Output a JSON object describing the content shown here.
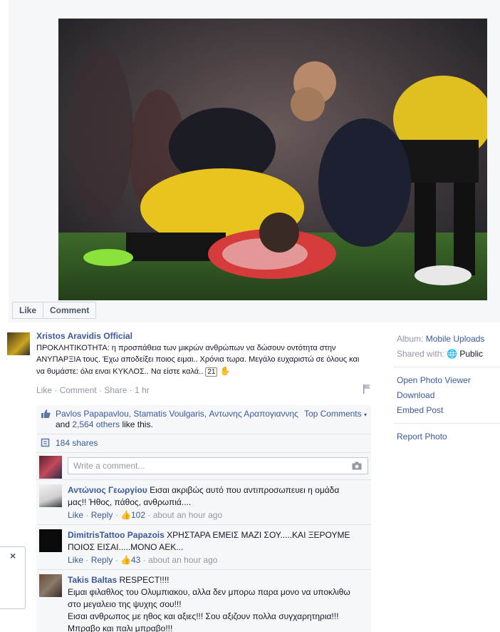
{
  "actions": {
    "like": "Like",
    "comment": "Comment"
  },
  "post": {
    "author": "Xristos Aravidis Official",
    "caption": "ΠΡΟΚΛΗΤΙΚΟΤΗΤΑ: η προσπάθεια των μικρών ανθρώπων να δώσουν οντότητα στην ΑΝΥΠΑΡΞΙΑ τους. Έχω αποδείξει ποιος ειμαι.. Χρόνια τωρα. Μεγάλο ευχαριστώ σε όλους και να θυμάστε: όλα ειναι ΚΥΚΛΟΣ.. Να είστε καλά..",
    "caption_tag": "21",
    "meta": {
      "like": "Like",
      "comment": "Comment",
      "share": "Share",
      "time": "1 hr"
    }
  },
  "likes": {
    "names": "Pavlos Papapavlou, Stamatis Voulgaris, Αντωνης Αραπογιαννης",
    "and": "and",
    "others": "2,564 others",
    "suffix": "like this.",
    "top_comments": "Top Comments",
    "shares": "184 shares",
    "write_placeholder": "Write a comment..."
  },
  "comments": [
    {
      "name": "Αντώνιος Γεωργίου",
      "lines": [
        "Εισαι ακριβώς αυτό που αντιπροσωπευει η ομάδα",
        "μας!! Ήθος, πάθος, ανθρωπιά...."
      ],
      "like": "Like",
      "reply": "Reply",
      "likes": "102",
      "time": "about an hour ago"
    },
    {
      "name": "DimitrisTattoo Papazois",
      "lines": [
        "ΧΡΗΣΤΑΡΑ ΕΜΕΙΣ ΜΑΖΙ ΣΟΥ.....ΚΑΙ ΞΕΡΟΥΜΕ",
        "ΠΟΙΟΣ ΕΙΣΑΙ.....ΜΟΝΟ ΑΕΚ..."
      ],
      "like": "Like",
      "reply": "Reply",
      "likes": "43",
      "time": "about an hour ago"
    },
    {
      "name": "Takis Baltas",
      "lines": [
        "RESPECT!!!!",
        "Ειμαι φιλαθλος του Ολυμπιακου, αλλα δεν μπορω παρα μονο να υποκλιθω",
        "στο μεγαλειο της ψυχης σου!!!",
        "Εισαι ανθρωπος με ηθος και αξιες!!! Σου αξιζουν πολλα συγχαρητηρια!!!",
        "Μπραβο και παλι μπραβο!!!"
      ]
    }
  ],
  "sidebar": {
    "album_label": "Album:",
    "album_value": "Mobile Uploads",
    "shared_label": "Shared with:",
    "shared_value": "Public",
    "options": [
      "Open Photo Viewer",
      "Download",
      "Embed Post"
    ],
    "report": "Report Photo"
  },
  "side_tab": {
    "close": "×"
  },
  "colors": {
    "link": "#3b5998",
    "muted": "#9197a3",
    "aek_yellow": "#f2cc17"
  }
}
